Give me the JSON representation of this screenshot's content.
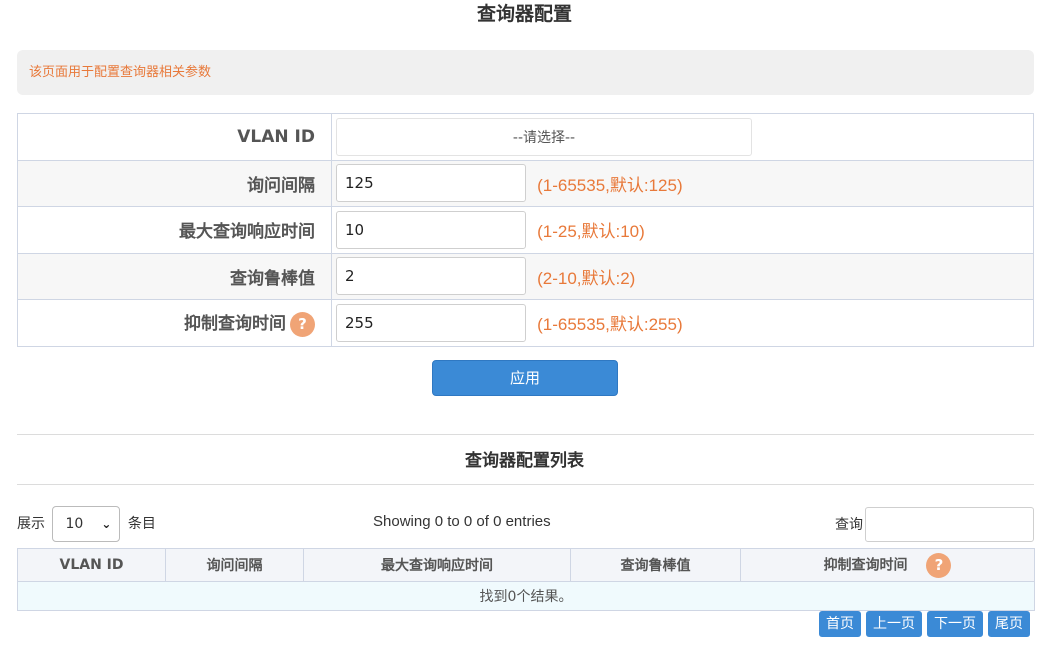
{
  "page": {
    "title": "查询器配置"
  },
  "notice": {
    "text": "该页面用于配置查询器相关参数"
  },
  "form": {
    "vlan": {
      "label": "VLAN ID",
      "placeholder": "--请选择--"
    },
    "interval": {
      "label": "询问间隔",
      "value": "125",
      "hint": "(1-65535,默认:125)"
    },
    "max_resp": {
      "label": "最大查询响应时间",
      "value": "10",
      "hint": "(1-25,默认:10)"
    },
    "robustness": {
      "label": "查询鲁棒值",
      "value": "2",
      "hint": "(2-10,默认:2)"
    },
    "suppress": {
      "label": "抑制查询时间",
      "value": "255",
      "hint": "(1-65535,默认:255)",
      "help": "?"
    }
  },
  "apply": {
    "label": "应用"
  },
  "list": {
    "title": "查询器配置列表",
    "show_prefix": "展示",
    "page_length": "10",
    "show_suffix": "条目",
    "info": "Showing 0 to 0 of 0 entries",
    "search_label": "查询",
    "columns": [
      "VLAN ID",
      "询问间隔",
      "最大查询响应时间",
      "查询鲁棒值",
      "抑制查询时间"
    ],
    "help": "?",
    "empty_text": "找到0个结果。"
  },
  "pager": {
    "first": "首页",
    "prev": "上一页",
    "next": "下一页",
    "last": "尾页"
  },
  "colors": {
    "accent": "#3b8ad6",
    "hint": "#e8793a",
    "help_icon": "#f0a476"
  }
}
